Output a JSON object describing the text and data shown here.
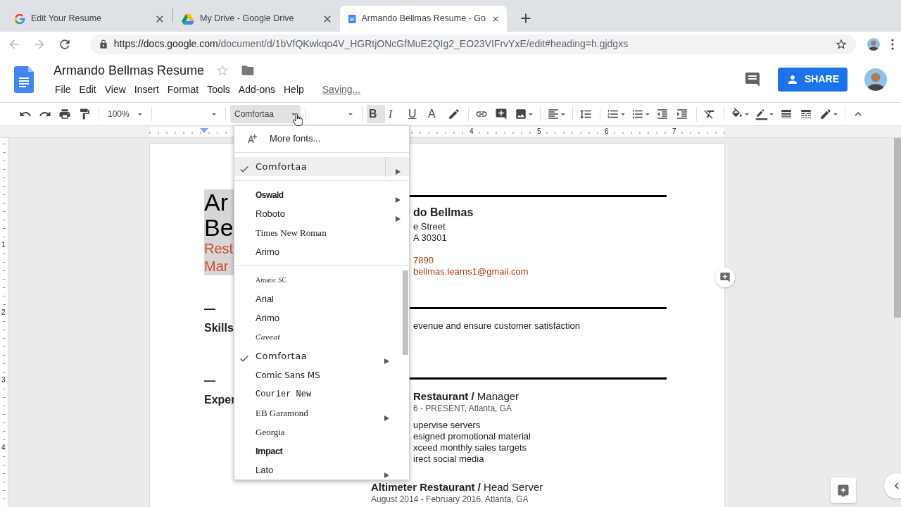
{
  "browser": {
    "tabs": [
      {
        "title": "Edit Your Resume",
        "kind": "google",
        "selected": false
      },
      {
        "title": "My Drive - Google Drive",
        "kind": "drive",
        "selected": false
      },
      {
        "title": "Armando Bellmas Resume - Go",
        "kind": "docs",
        "selected": true
      }
    ],
    "url": {
      "host": "https://docs.google.com",
      "path": "/document/d/1bVfQKwkqo4V_HGRtjONcGfMuE2QIg2_EO23VIFrvYxE/edit#heading=h.gjdgxs"
    }
  },
  "app": {
    "title": "Armando Bellmas Resume",
    "menus": [
      "File",
      "Edit",
      "View",
      "Insert",
      "Format",
      "Tools",
      "Add-ons",
      "Help"
    ],
    "save_status": "Saving...",
    "share_label": "SHARE"
  },
  "toolbar": {
    "items": [
      {
        "kind": "undo"
      },
      {
        "kind": "redo"
      },
      {
        "kind": "print"
      },
      {
        "kind": "paint"
      },
      {
        "kind": "sep"
      },
      {
        "kind": "zoom",
        "label": "100%",
        "expanded": false
      },
      {
        "kind": "sep"
      },
      {
        "kind": "style",
        "expanded": false
      },
      {
        "kind": "sep"
      },
      {
        "kind": "font",
        "label": "Comfortaa",
        "expanded": true
      },
      {
        "kind": "sep"
      },
      {
        "kind": "size",
        "expanded": false
      },
      {
        "kind": "sep"
      },
      {
        "kind": "bold",
        "label": "B",
        "active": true
      },
      {
        "kind": "italic",
        "label": "I",
        "active": false
      },
      {
        "kind": "underline",
        "label": "U",
        "active": false
      },
      {
        "kind": "textcolor",
        "label": "A"
      },
      {
        "kind": "highlight"
      },
      {
        "kind": "sep"
      },
      {
        "kind": "link"
      },
      {
        "kind": "comment"
      },
      {
        "kind": "image",
        "dropdown": true
      },
      {
        "kind": "sep"
      },
      {
        "kind": "align",
        "dropdown": true
      },
      {
        "kind": "sep"
      },
      {
        "kind": "linespacing"
      },
      {
        "kind": "sep"
      },
      {
        "kind": "numlist",
        "dropdown": true
      },
      {
        "kind": "bullist",
        "dropdown": true
      },
      {
        "kind": "outdent"
      },
      {
        "kind": "indent"
      },
      {
        "kind": "sep"
      },
      {
        "kind": "clearformat"
      },
      {
        "kind": "sep"
      },
      {
        "kind": "fill",
        "dropdown": true
      },
      {
        "kind": "bordercolor",
        "dropdown": true
      },
      {
        "kind": "borderweight"
      },
      {
        "kind": "borderdash"
      },
      {
        "kind": "editmode",
        "dropdown": true
      },
      {
        "kind": "sep"
      },
      {
        "kind": "collapse"
      }
    ]
  },
  "ruler": {
    "h_labels": [
      "4",
      "5",
      "6",
      "7"
    ],
    "v_labels": [
      "1",
      "2",
      "3",
      "4"
    ]
  },
  "page": {
    "header": {
      "name_lines": [
        "Ar",
        "Be"
      ],
      "role_lines": [
        "Rest",
        "Mar"
      ],
      "contact_name": "do Bellmas",
      "address_lines": [
        "e Street",
        "A 30301"
      ],
      "phone": "7890",
      "email": "bellmas.learns1@gmail.com"
    },
    "sections": [
      {
        "dash": "—",
        "heading": "Skills",
        "lines": [
          "evenue and ensure customer satisfaction"
        ]
      },
      {
        "dash": "—",
        "heading": "Exper",
        "jobs": [
          {
            "title": "**Restaurant /** Manager",
            "dates": "6 - PRESENT,  Atlanta, GA",
            "bullets": [
              "upervise servers",
              "esigned promotional material",
              "xceed monthly sales targets",
              "irect social media"
            ]
          },
          {
            "title": "**Altimeter Restaurant /** Head Server",
            "dates": "August 2014 - February 2016,  Atlanta, GA"
          }
        ]
      }
    ]
  },
  "font_menu": {
    "more_fonts": "More fonts...",
    "groups": [
      [
        {
          "label": "Comfortaa",
          "kind": "round",
          "checked": true,
          "submenu": true,
          "selected": true
        }
      ],
      [
        {
          "label": "Oswald",
          "kind": "condensed",
          "checked": false,
          "submenu": true,
          "selected": false
        },
        {
          "label": "Roboto",
          "kind": "sans",
          "checked": false,
          "submenu": true,
          "selected": false
        },
        {
          "label": "Times New Roman",
          "kind": "serif",
          "checked": false,
          "submenu": false,
          "selected": false
        },
        {
          "label": "Arimo",
          "kind": "sans",
          "checked": false,
          "submenu": false,
          "selected": false
        }
      ],
      [
        {
          "label": "Amatic SC",
          "kind": "thin",
          "checked": false,
          "submenu": false,
          "selected": false
        },
        {
          "label": "Arial",
          "kind": "sans",
          "checked": false,
          "submenu": false,
          "selected": false
        },
        {
          "label": "Arimo",
          "kind": "sans",
          "checked": false,
          "submenu": false,
          "selected": false
        },
        {
          "label": "Caveat",
          "kind": "script",
          "checked": false,
          "submenu": false,
          "selected": false
        },
        {
          "label": "Comfortaa",
          "kind": "round",
          "checked": true,
          "submenu": true,
          "selected": false
        },
        {
          "label": "Comic Sans MS",
          "kind": "comic",
          "checked": false,
          "submenu": false,
          "selected": false
        },
        {
          "label": "Courier New",
          "kind": "mono",
          "checked": false,
          "submenu": false,
          "selected": false
        },
        {
          "label": "EB Garamond",
          "kind": "serif",
          "checked": false,
          "submenu": true,
          "selected": false
        },
        {
          "label": "Georgia",
          "kind": "serif",
          "checked": false,
          "submenu": false,
          "selected": false
        },
        {
          "label": "Impact",
          "kind": "impact",
          "checked": false,
          "submenu": false,
          "selected": false
        },
        {
          "label": "Lato",
          "kind": "sans",
          "checked": false,
          "submenu": true,
          "selected": false
        }
      ]
    ]
  }
}
